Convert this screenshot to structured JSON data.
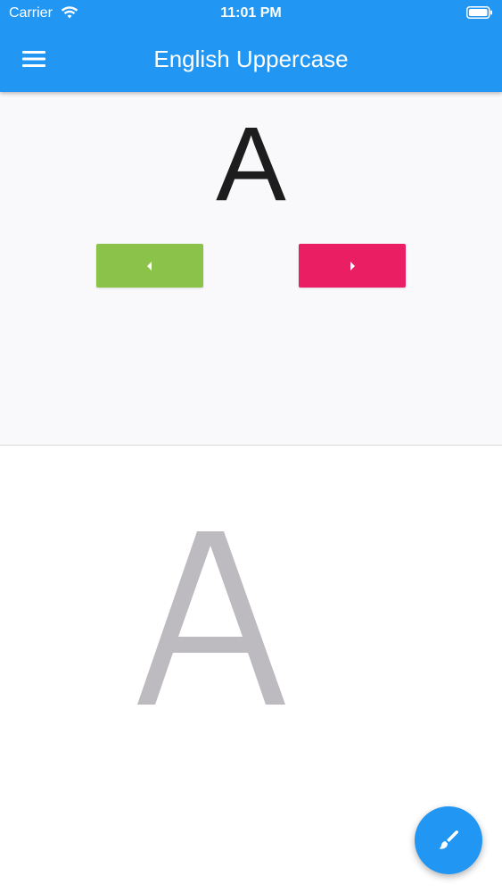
{
  "status_bar": {
    "carrier": "Carrier",
    "time": "11:01 PM",
    "wifi_icon": "wifi-icon",
    "battery_icon": "battery-icon"
  },
  "app_bar": {
    "title": "English Uppercase",
    "menu_icon": "hamburger-menu-icon",
    "background_color": "#2196F3"
  },
  "letter_panel": {
    "current_letter": "A",
    "prev_button": {
      "icon": "arrow-left-icon",
      "color": "#8BC34A"
    },
    "next_button": {
      "icon": "arrow-right-icon",
      "color": "#E91E63"
    }
  },
  "trace_panel": {
    "guide_letter": "A",
    "guide_color": "#BDBBC0"
  },
  "fab": {
    "icon": "paintbrush-icon",
    "color": "#2196F3"
  }
}
